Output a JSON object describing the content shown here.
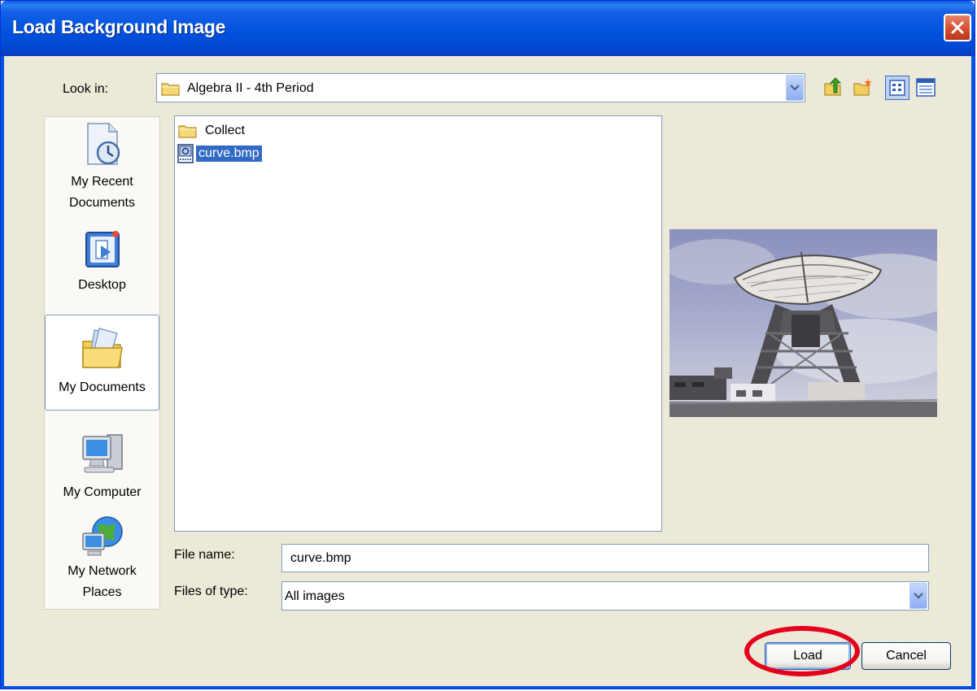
{
  "window": {
    "title": "Load Background Image"
  },
  "lookin": {
    "label": "Look in:",
    "value": "Algebra II - 4th Period"
  },
  "toolbar": {
    "icons": [
      "up-folder-icon",
      "new-folder-icon",
      "list-view-icon",
      "details-view-icon"
    ]
  },
  "places": [
    {
      "label": "My Recent Documents",
      "icon": "recent-documents-icon"
    },
    {
      "label": "Desktop",
      "icon": "desktop-icon"
    },
    {
      "label": "My Documents",
      "icon": "my-documents-icon",
      "selected": true
    },
    {
      "label": "My Computer",
      "icon": "my-computer-icon"
    },
    {
      "label": "My Network Places",
      "icon": "network-places-icon"
    }
  ],
  "files": [
    {
      "name": "Collect",
      "type": "folder"
    },
    {
      "name": "curve.bmp",
      "type": "image",
      "selected": true
    }
  ],
  "filename": {
    "label": "File name:",
    "value": "curve.bmp"
  },
  "filetype": {
    "label": "Files of type:",
    "value": "All images"
  },
  "buttons": {
    "load": "Load",
    "cancel": "Cancel"
  },
  "colors": {
    "title_bar": "#0052df",
    "selection": "#316ac5",
    "annotation": "#e4001b"
  }
}
